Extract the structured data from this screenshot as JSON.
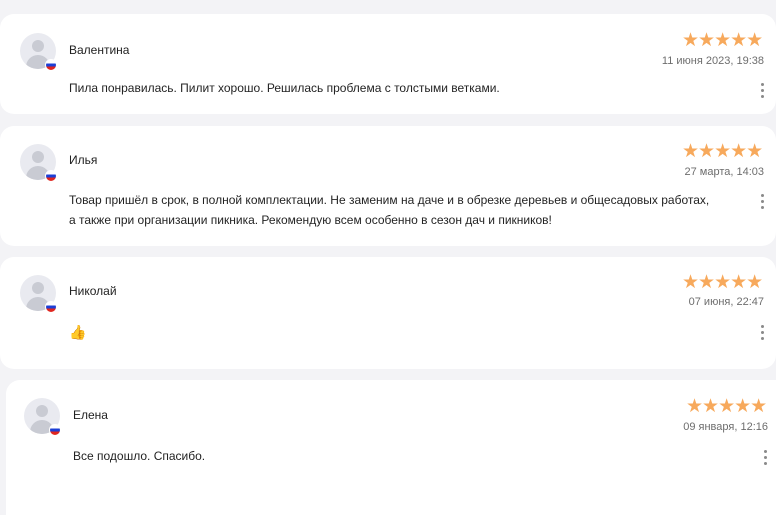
{
  "reviews": [
    {
      "author": "Валентина",
      "rating": 5,
      "stars": "★★★★★",
      "date": "11 июня 2023, 19:38",
      "text": "Пила понравилась. Пилит хорошо. Решилась проблема с толстыми ветками."
    },
    {
      "author": "Илья",
      "rating": 5,
      "stars": "★★★★★",
      "date": "27 марта, 14:03",
      "text": "Товар пришёл в срок, в полной комплектации. Не заменим на даче и в обрезке деревьев и общесадовых работах, а также при организации пикника. Рекомендую всем особенно в сезон дач и пикников!"
    },
    {
      "author": "Николай",
      "rating": 5,
      "stars": "★★★★★",
      "date": "07 июня, 22:47",
      "text": "👍"
    },
    {
      "author": "Елена",
      "rating": 5,
      "stars": "★★★★★",
      "date": "09 января, 12:16",
      "text": "Все подошло. Спасибо."
    }
  ],
  "colors": {
    "star": "#f7a95c",
    "background": "#f3f3f6",
    "card": "#ffffff",
    "flag_white": "#ffffff",
    "flag_blue": "#1c3fd6",
    "flag_red": "#e0261f"
  },
  "icons": {
    "avatar": "user-placeholder-icon",
    "flag": "russia-flag-icon",
    "more": "more-vertical-icon"
  }
}
